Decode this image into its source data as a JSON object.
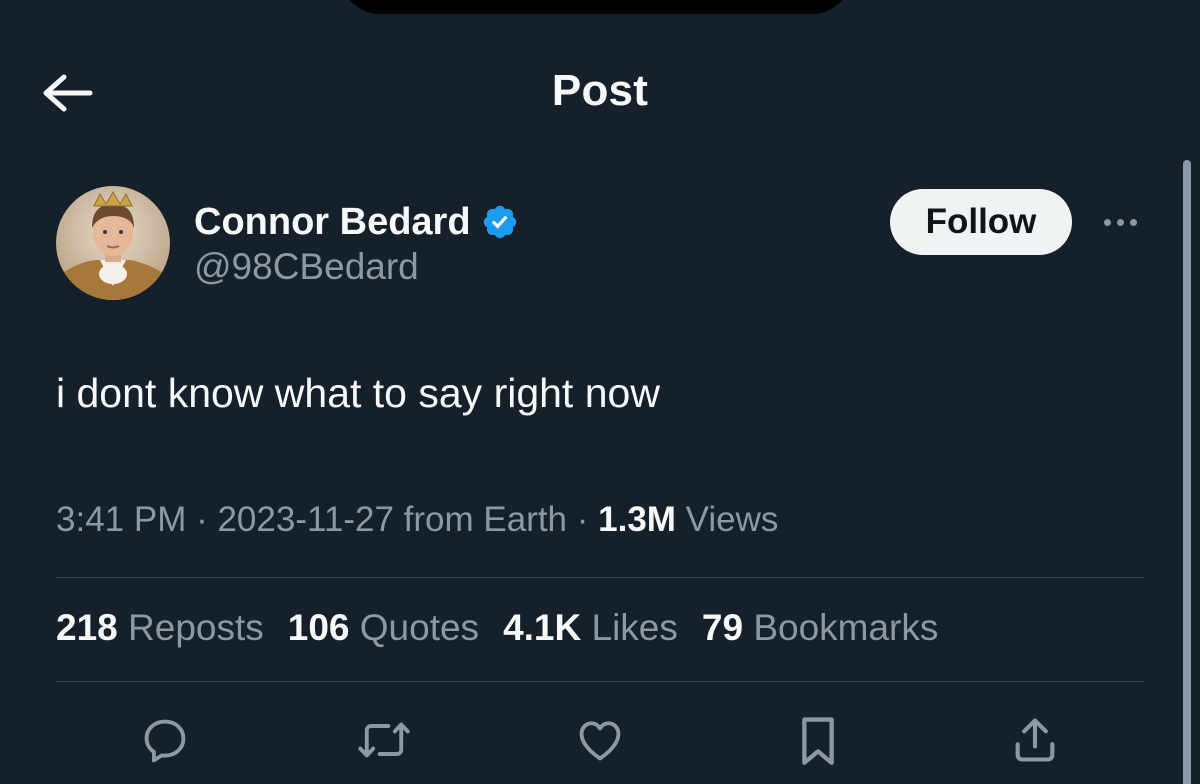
{
  "header": {
    "title": "Post",
    "back_icon": "arrow-left-icon"
  },
  "author": {
    "name": "Connor Bedard",
    "handle": "@98CBedard",
    "verified": true,
    "verified_icon": "verified-badge-icon",
    "avatar": "avatar-image"
  },
  "follow_label": "Follow",
  "more_icon": "more-options-icon",
  "post": {
    "text": "i dont know what to say right now"
  },
  "meta": {
    "time": "3:41 PM",
    "sep1": " · ",
    "date": "2023-11-27",
    "source": " from Earth",
    "sep2": " · ",
    "views_count": "1.3M",
    "views_label": " Views"
  },
  "stats": [
    {
      "count": "218",
      "label": "Reposts"
    },
    {
      "count": "106",
      "label": "Quotes"
    },
    {
      "count": "4.1K",
      "label": "Likes"
    },
    {
      "count": "79",
      "label": "Bookmarks"
    }
  ],
  "actions": [
    {
      "icon": "reply-icon"
    },
    {
      "icon": "repost-icon"
    },
    {
      "icon": "like-icon"
    },
    {
      "icon": "bookmark-icon"
    },
    {
      "icon": "share-icon"
    }
  ],
  "colors": {
    "background": "#15202b",
    "text_primary": "#f7f9f9",
    "text_secondary": "#8b98a5",
    "divider": "#38444d",
    "verified_blue": "#1d9bf0",
    "follow_bg": "#eff3f4"
  }
}
